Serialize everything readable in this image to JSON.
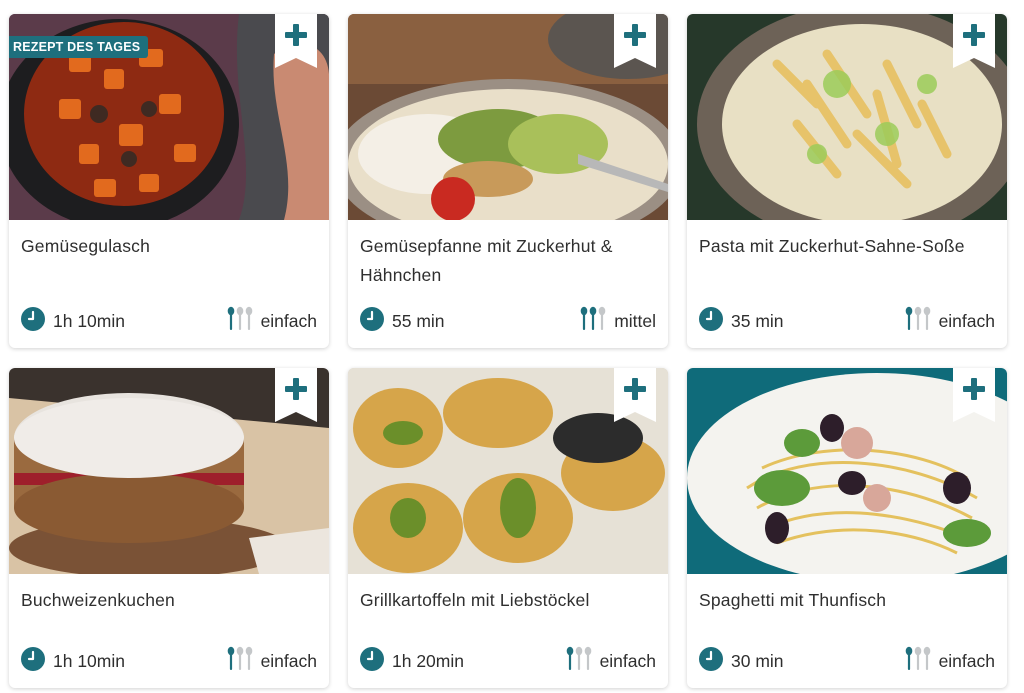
{
  "colors": {
    "accent": "#1e6f7d",
    "spoon_inactive": "#c4c7c9",
    "text": "#2f2f2f"
  },
  "icons": {
    "bookmark": "plus-bookmark-icon",
    "time": "clock-icon",
    "difficulty": "spoons-icon"
  },
  "cards": [
    {
      "title": "Gemüsegulasch",
      "badge": "REZEPT DES TAGES",
      "time": "1h 10min",
      "difficulty": "einfach",
      "difficulty_level": 1
    },
    {
      "title": "Gemüsepfanne mit Zuckerhut & Hähnchen",
      "time": "55 min",
      "difficulty": "mittel",
      "difficulty_level": 2
    },
    {
      "title": "Pasta mit Zuckerhut-Sahne-Soße",
      "time": "35 min",
      "difficulty": "einfach",
      "difficulty_level": 1
    },
    {
      "title": "Buchweizenkuchen",
      "time": "1h 10min",
      "difficulty": "einfach",
      "difficulty_level": 1
    },
    {
      "title": "Grillkartoffeln mit Liebstöckel",
      "time": "1h 20min",
      "difficulty": "einfach",
      "difficulty_level": 1
    },
    {
      "title": "Spaghetti mit Thunfisch",
      "time": "30 min",
      "difficulty": "einfach",
      "difficulty_level": 1
    }
  ]
}
